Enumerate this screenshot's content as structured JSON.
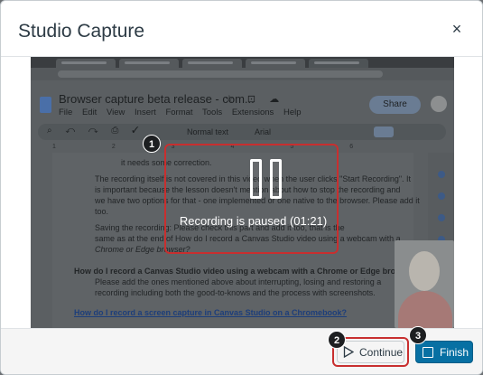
{
  "modal": {
    "title": "Studio Capture",
    "close_icon": "close-icon",
    "close_glyph": "×"
  },
  "capture": {
    "doc_title": "Browser capture beta release - com...",
    "menu": [
      "File",
      "Edit",
      "View",
      "Insert",
      "Format",
      "Tools",
      "Extensions",
      "Help"
    ],
    "share_label": "Share",
    "style_select": "Normal text",
    "font_select": "Arial",
    "ruler_ticks": "1 2 3 4 5 6",
    "lines": [
      "it needs some correction.",
      "The recording itself is not covered in this video when the user clicks \"Start Recording\". It",
      "is important because the lesson doesn't mention about how to stop the recording and",
      "we have two options for that - one implemented or one native to the browser. Please add it",
      "too.",
      "Saving the recording: Please check this part and add it too, that is the",
      "same as at the end of How do I record a Canvas Studio video using a webcam with a",
      "Chrome or Edge browser?",
      "How do I record a Canvas Studio video using a webcam with a Chrome or Edge browser?",
      "Please add the ones mentioned above about interrupting, losing and restoring a",
      "recording including both the good-to-knows and the process with screenshots.",
      "How do I record a screen capture in Canvas Studio on a Chromebook?"
    ],
    "paused_text": "Recording is paused (01:21)"
  },
  "callouts": [
    "1",
    "2",
    "3"
  ],
  "footer": {
    "continue_label": "Continue",
    "finish_label": "Finish"
  },
  "colors": {
    "highlight": "#c82f2f",
    "primary": "#0770a3"
  }
}
